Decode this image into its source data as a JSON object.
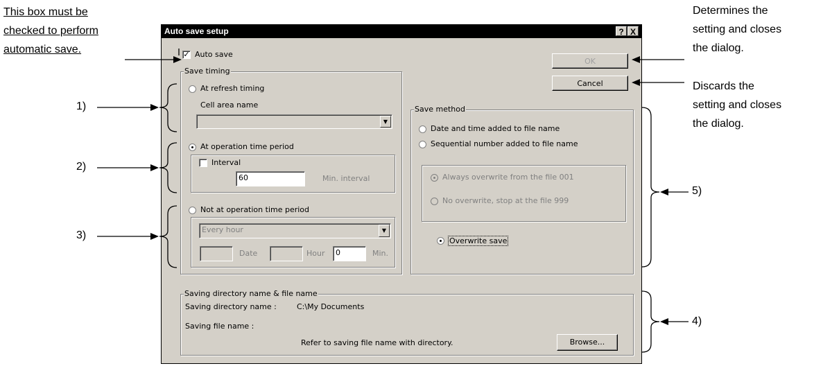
{
  "annotations": {
    "top_left_note": [
      "This box must be",
      "checked to perform",
      "automatic save."
    ],
    "ok_note": [
      "Determines the",
      "setting and closes",
      "the dialog."
    ],
    "cancel_note": [
      "Discards the",
      "setting and closes",
      "the dialog."
    ],
    "label_1": "1)",
    "label_2": "2)",
    "label_3": "3)",
    "label_4": "4)",
    "label_5": "5)"
  },
  "dialog": {
    "title": "Auto save setup",
    "help_icon": "?",
    "close_icon": "X",
    "auto_save_label": "Auto save",
    "auto_save_checked": true,
    "ok_label": "OK",
    "cancel_label": "Cancel",
    "save_timing": {
      "title": "Save timing",
      "refresh_label": "At refresh timing",
      "cell_area_label": "Cell area name",
      "cell_area_value": "",
      "operation_label": "At operation time period",
      "interval_label": "Interval",
      "interval_value": "60",
      "interval_unit": "Min. interval",
      "not_operation_label": "Not at operation time period",
      "period_select": "Every hour",
      "date_value": "",
      "date_label": "Date",
      "hour_value": "",
      "hour_label": "Hour",
      "min_value": "0",
      "min_label": "Min."
    },
    "save_method": {
      "title": "Save method",
      "date_time_label": "Date and time added to file name",
      "sequential_label": "Sequential number added to file name",
      "always_overwrite_label": "Always overwrite from the file 001",
      "no_overwrite_label": "No overwrite, stop at the file 999",
      "overwrite_save_label": "Overwrite save"
    },
    "saving": {
      "title": "Saving directory name & file name",
      "dir_label": "Saving directory name :",
      "dir_value": "C:\\My Documents",
      "file_label": "Saving file name :",
      "refer_text": "Refer to saving file name with directory.",
      "browse_label": "Browse..."
    }
  }
}
